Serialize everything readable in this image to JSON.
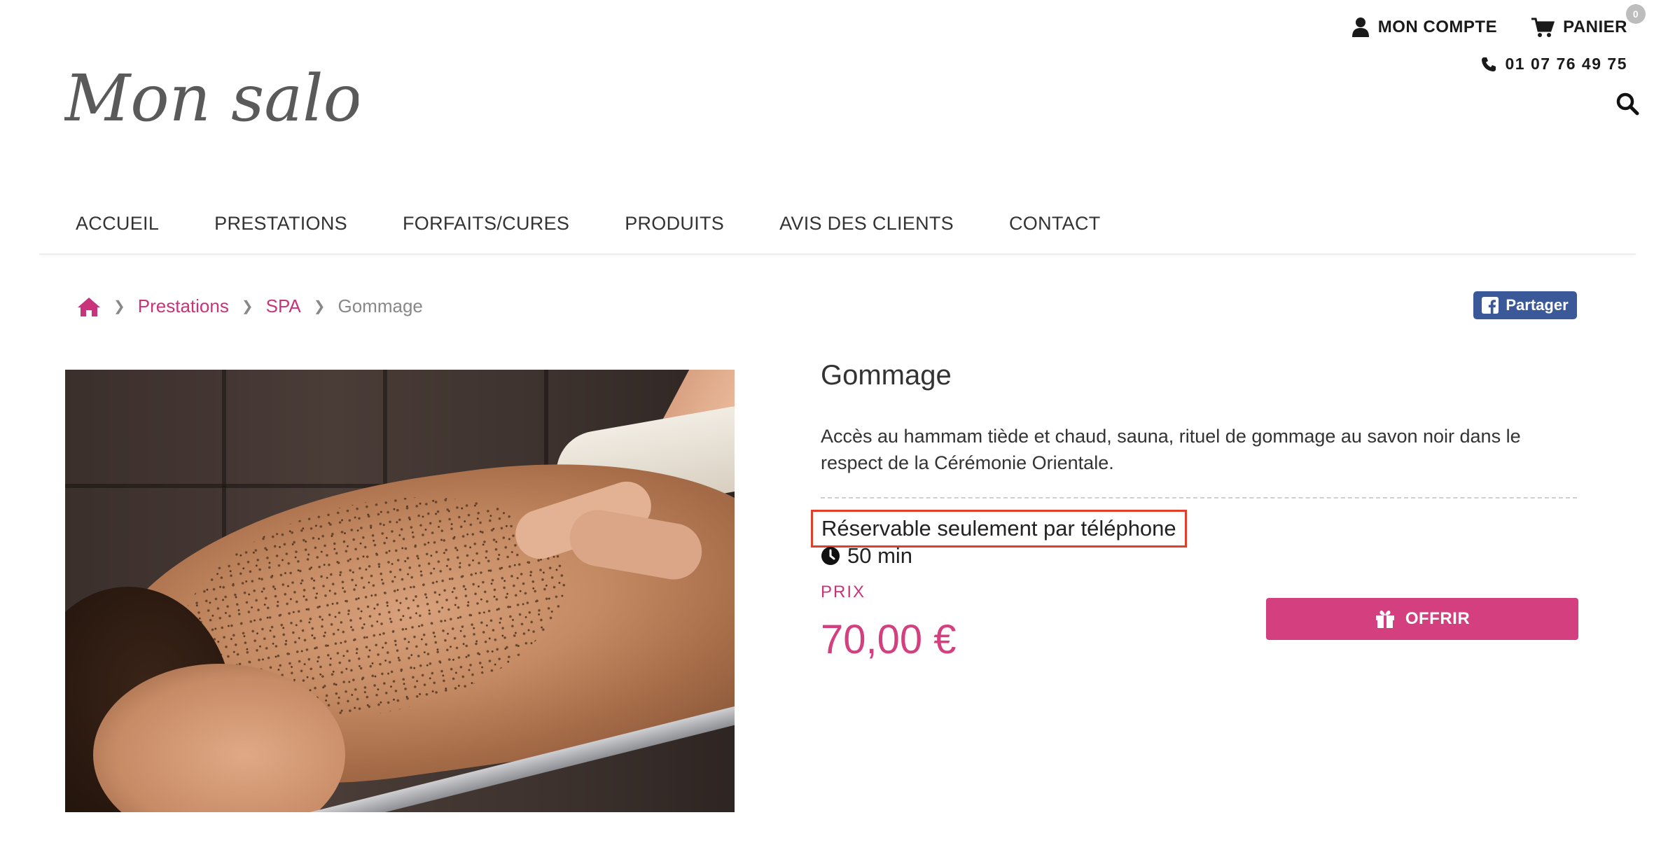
{
  "brand": {
    "logo_text": "Mon salon"
  },
  "header": {
    "account_label": "MON COMPTE",
    "cart_label": "PANIER",
    "cart_count": "0",
    "phone": "01 07 76 49 75"
  },
  "nav": {
    "items": [
      "ACCUEIL",
      "PRESTATIONS",
      "FORFAITS/CURES",
      "PRODUITS",
      "AVIS DES CLIENTS",
      "CONTACT"
    ]
  },
  "breadcrumb": {
    "items": [
      "Prestations",
      "SPA"
    ],
    "current": "Gommage"
  },
  "share": {
    "label": "Partager"
  },
  "product": {
    "title": "Gommage",
    "description": "Accès au hammam tiède et chaud, sauna, rituel de gommage au savon noir dans le respect de la Cérémonie Orientale.",
    "booking_note": "Réservable seulement par téléphone",
    "duration": "50 min",
    "price_label": "PRIX",
    "price": "70,00 €",
    "offer_label": "OFFRIR"
  },
  "colors": {
    "accent": "#d4407f",
    "link": "#c7347a",
    "facebook": "#3b5998",
    "highlight_border": "#e0402a"
  }
}
